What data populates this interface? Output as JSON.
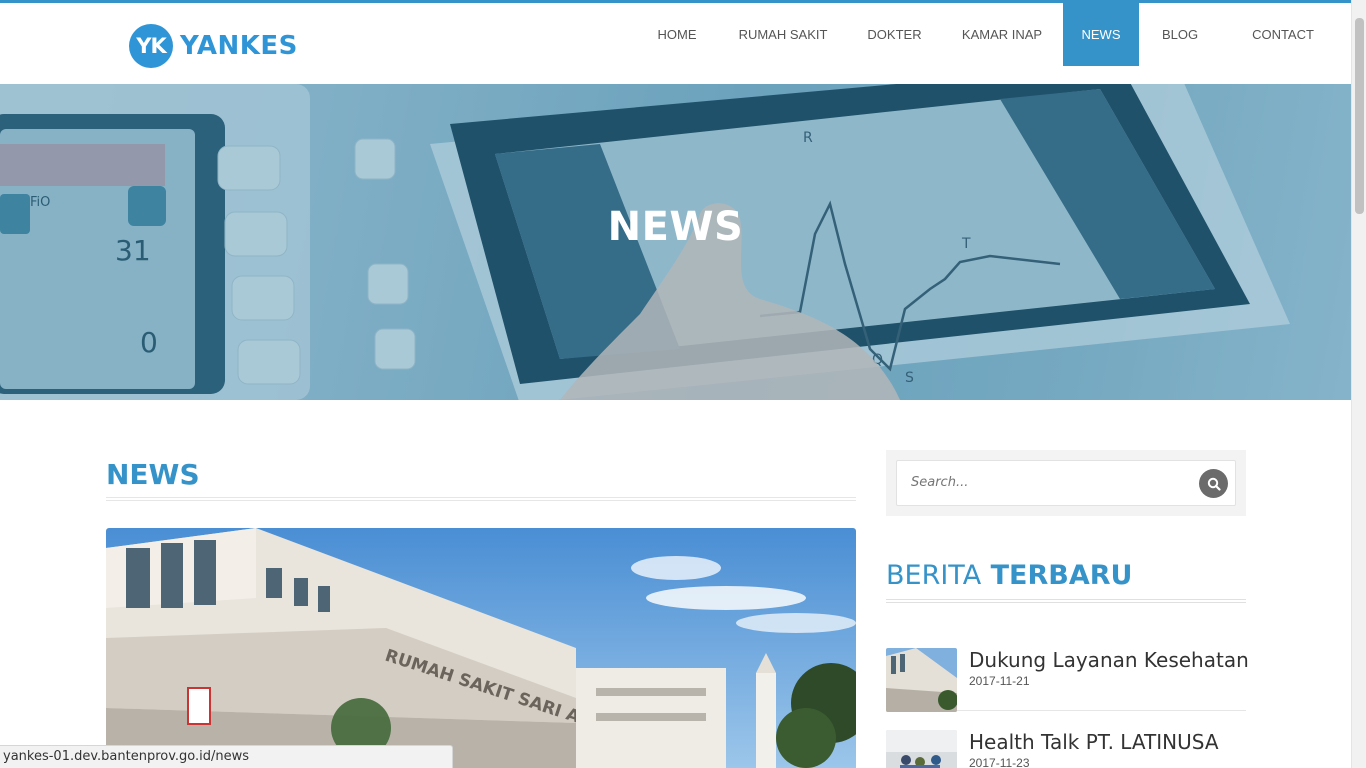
{
  "brand": {
    "badge": "YK",
    "name": "YANKES",
    "accent_color": "#3593c9",
    "logo_color": "#2f95d6"
  },
  "nav": {
    "items": [
      {
        "label": "HOME",
        "active": false
      },
      {
        "label": "RUMAH SAKIT",
        "active": false
      },
      {
        "label": "DOKTER",
        "active": false
      },
      {
        "label": "KAMAR INAP",
        "active": false
      },
      {
        "label": "NEWS",
        "active": true
      },
      {
        "label": "BLOG",
        "active": false
      },
      {
        "label": "CONTACT",
        "active": false
      }
    ]
  },
  "hero": {
    "title": "NEWS",
    "image": "medical-tablet-heart-monitor-photo"
  },
  "main": {
    "section_title": "NEWS",
    "feature_image": "hospital-building-photo",
    "building_sign": "RUMAH SAKIT SARI ASIH SERANG"
  },
  "sidebar": {
    "search": {
      "placeholder": "Search...",
      "icon": "search-icon"
    },
    "latest": {
      "title_light": "BERITA",
      "title_strong": "TERBARU",
      "posts": [
        {
          "title": "Dukung Layanan Kesehatan",
          "date": "2017-11-21",
          "thumb": "hospital-building-thumb"
        },
        {
          "title": "Health Talk PT. LATINUSA",
          "date": "2017-11-23",
          "thumb": "health-talk-thumb"
        }
      ]
    }
  },
  "status_bar": {
    "url": "yankes-01.dev.bantenprov.go.id/news"
  }
}
